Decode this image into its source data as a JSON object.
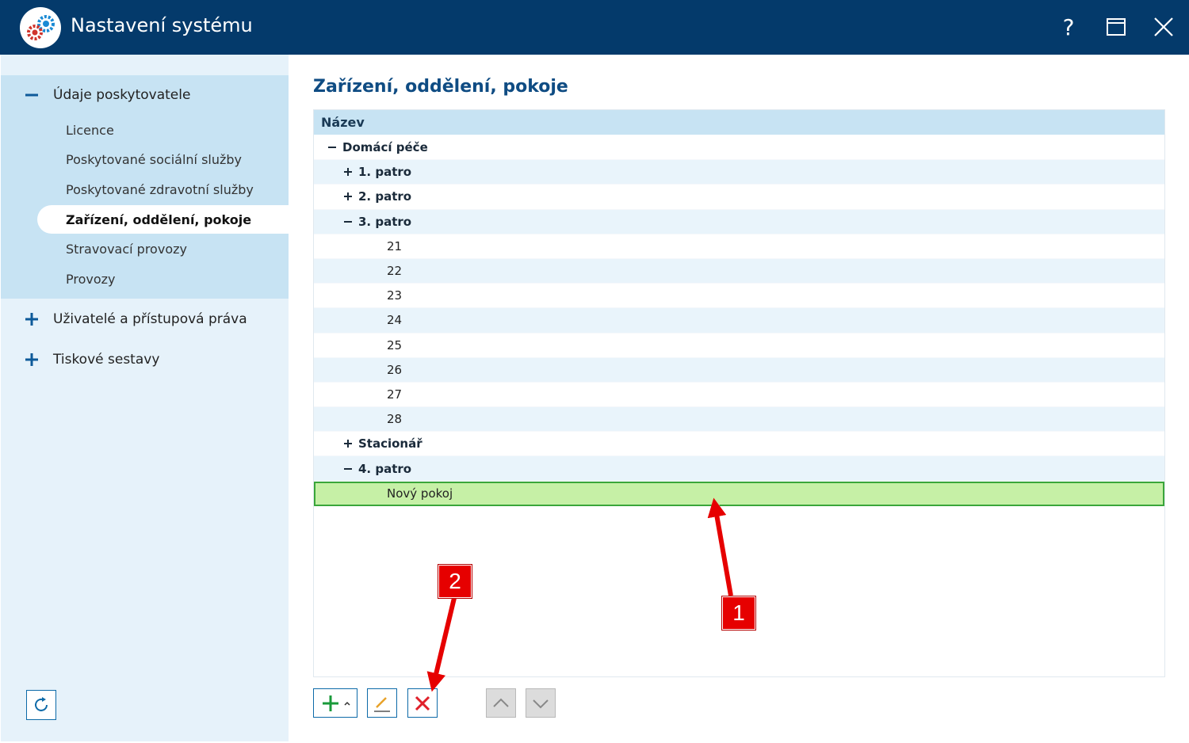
{
  "window": {
    "title": "Nastavení systému",
    "help_glyph": "?",
    "icons": {
      "logo": "gears-icon",
      "help": "help-icon",
      "maximize": "maximize-icon",
      "close": "close-icon"
    },
    "colors": {
      "titlebar": "#043a6b",
      "accent": "#0d6aa8",
      "sidebar_bg": "#e6f2fa",
      "sidebar_group_bg": "#c7e3f3",
      "selected_row": "#c6f0a6",
      "selected_border": "#3aa63a",
      "annotation": "#e60000"
    }
  },
  "sidebar": {
    "groups": [
      {
        "label": "Údaje poskytovatele",
        "expanded": true,
        "items": [
          {
            "label": "Licence",
            "active": false
          },
          {
            "label": "Poskytované sociální služby",
            "active": false
          },
          {
            "label": "Poskytované zdravotní služby",
            "active": false
          },
          {
            "label": "Zařízení, oddělení, pokoje",
            "active": true
          },
          {
            "label": "Stravovací provozy",
            "active": false
          },
          {
            "label": "Provozy",
            "active": false
          }
        ]
      },
      {
        "label": "Uživatelé a přístupová práva",
        "expanded": false
      },
      {
        "label": "Tiskové sestavy",
        "expanded": false
      }
    ],
    "refresh_icon": "refresh-icon"
  },
  "main": {
    "title": "Zařízení, oddělení, pokoje",
    "grid": {
      "column_header": "Název",
      "rows": [
        {
          "label": "Domácí péče",
          "level": 0,
          "toggle": "minus",
          "bold": true
        },
        {
          "label": "1. patro",
          "level": 1,
          "toggle": "plus",
          "bold": true
        },
        {
          "label": "2. patro",
          "level": 1,
          "toggle": "plus",
          "bold": true
        },
        {
          "label": "3. patro",
          "level": 1,
          "toggle": "minus",
          "bold": true
        },
        {
          "label": "21",
          "level": 2,
          "toggle": "",
          "bold": false
        },
        {
          "label": "22",
          "level": 2,
          "toggle": "",
          "bold": false
        },
        {
          "label": "23",
          "level": 2,
          "toggle": "",
          "bold": false
        },
        {
          "label": "24",
          "level": 2,
          "toggle": "",
          "bold": false
        },
        {
          "label": "25",
          "level": 2,
          "toggle": "",
          "bold": false
        },
        {
          "label": "26",
          "level": 2,
          "toggle": "",
          "bold": false
        },
        {
          "label": "27",
          "level": 2,
          "toggle": "",
          "bold": false
        },
        {
          "label": "28",
          "level": 2,
          "toggle": "",
          "bold": false
        },
        {
          "label": "Stacionář",
          "level": 1,
          "toggle": "plus",
          "bold": true
        },
        {
          "label": "4. patro",
          "level": 1,
          "toggle": "minus",
          "bold": true
        },
        {
          "label": "Nový pokoj",
          "level": 2,
          "toggle": "",
          "bold": false,
          "selected": true
        }
      ]
    },
    "toolbar": {
      "add": {
        "icon": "plus-icon",
        "dropdown_icon": "caret-up-icon"
      },
      "edit": {
        "icon": "pencil-icon"
      },
      "delete": {
        "icon": "delete-x-icon"
      },
      "move_up": {
        "icon": "chevron-up-icon",
        "disabled": true
      },
      "move_down": {
        "icon": "chevron-down-icon",
        "disabled": true
      }
    }
  },
  "annotations": [
    {
      "number": "1",
      "points_to": "Nový pokoj"
    },
    {
      "number": "2",
      "points_to": "delete button"
    }
  ]
}
